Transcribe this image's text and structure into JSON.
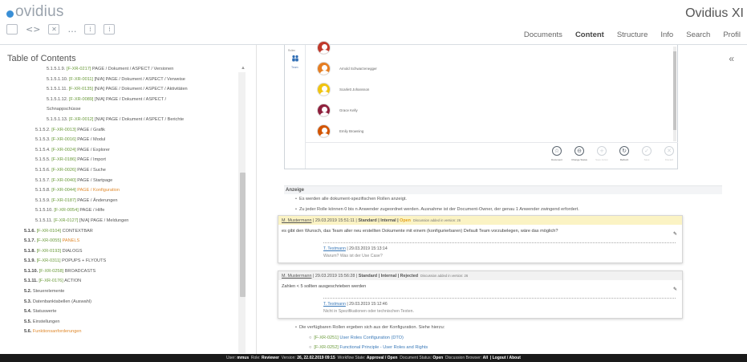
{
  "header": {
    "logo_text": "ovidius",
    "app_title": "Ovidius XI",
    "toolbar_icons": [
      "window-icon",
      "code-icon",
      "close-box-icon",
      "ellipsis-icon",
      "nav-box-icon",
      "nav-box-icon"
    ],
    "nav": [
      "Documents",
      "Content",
      "Structure",
      "Info",
      "Search",
      "Profil"
    ],
    "active_nav": "Content"
  },
  "toc": {
    "title": "Table of Contents",
    "items": [
      {
        "num": "5.1.5.1.9.",
        "req": "[F-XR-0217]",
        "text": "PAGE / Dokument / ASPECT / Versionen",
        "indent": 3
      },
      {
        "num": "5.1.5.1.10.",
        "req": "[F-XR-0011]",
        "text": "[N/A] PAGE / Dokument / ASPECT / Verweise",
        "indent": 3
      },
      {
        "num": "5.1.5.1.11.",
        "req": "[F-XR-0135]",
        "text": "[N/A] PAGE / Dokument / ASPECT / Aktivitäten",
        "indent": 3
      },
      {
        "num": "5.1.5.1.12.",
        "req": "[F-XR-0089]",
        "text": "[N/A] PAGE / Dokument / ASPECT /",
        "indent": 3
      },
      {
        "num": "",
        "req": "",
        "text": "Schnappschüsse",
        "indent": 3
      },
      {
        "num": "5.1.5.1.13.",
        "req": "[F-XR-0012]",
        "text": "[N/A] PAGE / Dokument / ASPECT / Berichte",
        "indent": 3
      },
      {
        "num": "5.1.5.2.",
        "req": "[F-XR-0013]",
        "text": "PAGE / Grafik",
        "indent": 2
      },
      {
        "num": "5.1.5.3.",
        "req": "[F-XR-0016]",
        "text": "PAGE / Modul",
        "indent": 2
      },
      {
        "num": "5.1.5.4.",
        "req": "[F-XR-0024]",
        "text": "PAGE / Explorer",
        "indent": 2
      },
      {
        "num": "5.1.5.5.",
        "req": "[F-XR-0186]",
        "text": "PAGE / Import",
        "indent": 2
      },
      {
        "num": "5.1.5.6.",
        "req": "[F-XR-0026]",
        "text": "PAGE / Suche",
        "indent": 2
      },
      {
        "num": "5.1.5.7.",
        "req": "[F-XR-0040]",
        "text": "PAGE / Startpage",
        "indent": 2
      },
      {
        "num": "5.1.5.8.",
        "req": "[F-XR-0044]",
        "text": "PAGE / Konfiguration",
        "indent": 2,
        "highlight": true
      },
      {
        "num": "5.1.5.9.",
        "req": "[F-XR-0187]",
        "text": "PAGE / Änderungen",
        "indent": 2
      },
      {
        "num": "5.1.5.10.",
        "req": "[F-XR-0054]",
        "text": "PAGE / Hilfe",
        "indent": 2
      },
      {
        "num": "5.1.5.11.",
        "req": "[F-XR-0127]",
        "text": "[N/A] PAGE / Meldungen",
        "indent": 2
      },
      {
        "num": "5.1.6.",
        "req": "[F-XR-0104]",
        "text": "CONTEXTBAR",
        "indent": 1
      },
      {
        "num": "5.1.7.",
        "req": "[F-XR-0055]",
        "text": "PANELS",
        "indent": 1,
        "highlight": true
      },
      {
        "num": "5.1.8.",
        "req": "[F-XR-0193]",
        "text": "DIALOGS",
        "indent": 1
      },
      {
        "num": "5.1.9.",
        "req": "[F-XR-0311]",
        "text": "POPUPS + FLYOUTS",
        "indent": 1
      },
      {
        "num": "5.1.10.",
        "req": "[F-XR-0258]",
        "text": "BROADCASTS",
        "indent": 1
      },
      {
        "num": "5.1.11.",
        "req": "[F-XR-0176]",
        "text": "ACTION",
        "indent": 1
      },
      {
        "num": "5.2.",
        "req": "",
        "text": "Steuerelemente",
        "indent": 0
      },
      {
        "num": "5.3.",
        "req": "",
        "text": "Datenbanktabellen (Auswahl)",
        "indent": 0
      },
      {
        "num": "5.4.",
        "req": "",
        "text": "Statuswerte",
        "indent": 0
      },
      {
        "num": "5.5.",
        "req": "",
        "text": "Einstellungen",
        "indent": 0
      },
      {
        "num": "5.6.",
        "req": "",
        "text": "Funktionsanforderungen",
        "indent": 0,
        "highlight": true
      }
    ]
  },
  "embed": {
    "side_label": "Rollen",
    "team_label": "Team",
    "people": [
      {
        "name": "",
        "color": "#c0392b"
      },
      {
        "name": "Arnold Schwarzenegger",
        "color": "#e67e22"
      },
      {
        "name": "Scarlett Johansson",
        "color": "#f1c40f"
      },
      {
        "name": "Grace Kelly",
        "color": "#8e1f3c"
      },
      {
        "name": "Emily Browning",
        "color": "#d35400"
      }
    ],
    "actions": [
      {
        "label": "Document",
        "glyph": "☆",
        "enabled": true
      },
      {
        "label": "Change Status",
        "glyph": "⊖",
        "enabled": true
      },
      {
        "label": "Save Action",
        "glyph": "+",
        "enabled": false
      },
      {
        "label": "Refresh",
        "glyph": "↻",
        "enabled": true
      },
      {
        "label": "Save",
        "glyph": "✓",
        "enabled": false
      },
      {
        "label": "Discard",
        "glyph": "✕",
        "enabled": false
      }
    ]
  },
  "content": {
    "section_title": "Anzeige",
    "bullet1": "Es werden alle dokument-spezifischen Rollen anzeigt.",
    "bullet2": "Zu jeder Rolle können 0 bis n Anwender zugeordnet werden. Ausnahme ist der Document-Owner, der genau 1 Anwender zwingend erfordert.",
    "discussion1": {
      "author": "M. Mustermann",
      "date": "29.03.2019 15:51:11",
      "tags": "Standard | Internal | ",
      "status": "Open",
      "note": "Discussion added in version: 26",
      "body": "es gibt den Wunsch, das Team aller neu erstellten Dokumente mit einem (konfigurierbaren) Default Team  vorzubelegen, wäre das möglich?",
      "reply_author": "T. Testmann",
      "reply_date": "29.03.2019 15:13:14",
      "reply_text": "Warum? Was ist der Use Case?"
    },
    "discussion2": {
      "author": "M. Mustermann",
      "date": "29.03.2019 15:56:28",
      "tags": "Standard | Internal | Rejected",
      "note": "Discussion added in version: 26",
      "body": "Zahlen < 5 sollten ausgeschrieben werden",
      "reply_author": "T. Testmann",
      "reply_date": "29.03.2019 15:12:46",
      "reply_text": "Nicht in Spezifikationen oder technischen Texten."
    },
    "bullet3": "Die verfügbaren Rollen ergeben sich aus der Konfiguration. Siehe hierzu:",
    "links": [
      {
        "req": "[F-XR-0251]",
        "text": "User Roles Configuration (DTO)"
      },
      {
        "req": "[F-XR-0252]",
        "text": "Functional Principle - User Roles and Rights"
      }
    ]
  },
  "statusbar": {
    "user_label": "User:",
    "user": "mmus",
    "role_label": "Role:",
    "role": "Reviewer",
    "version_label": "Version:",
    "version": "26, 22.02.2019 09:15",
    "workflow_label": "Workflow State:",
    "workflow": "Approval / Open",
    "docstatus_label": "Document Status:",
    "docstatus": "Open",
    "discussion_label": "Discussion Browser:",
    "discussion": "All",
    "links": "| Logout / About"
  }
}
